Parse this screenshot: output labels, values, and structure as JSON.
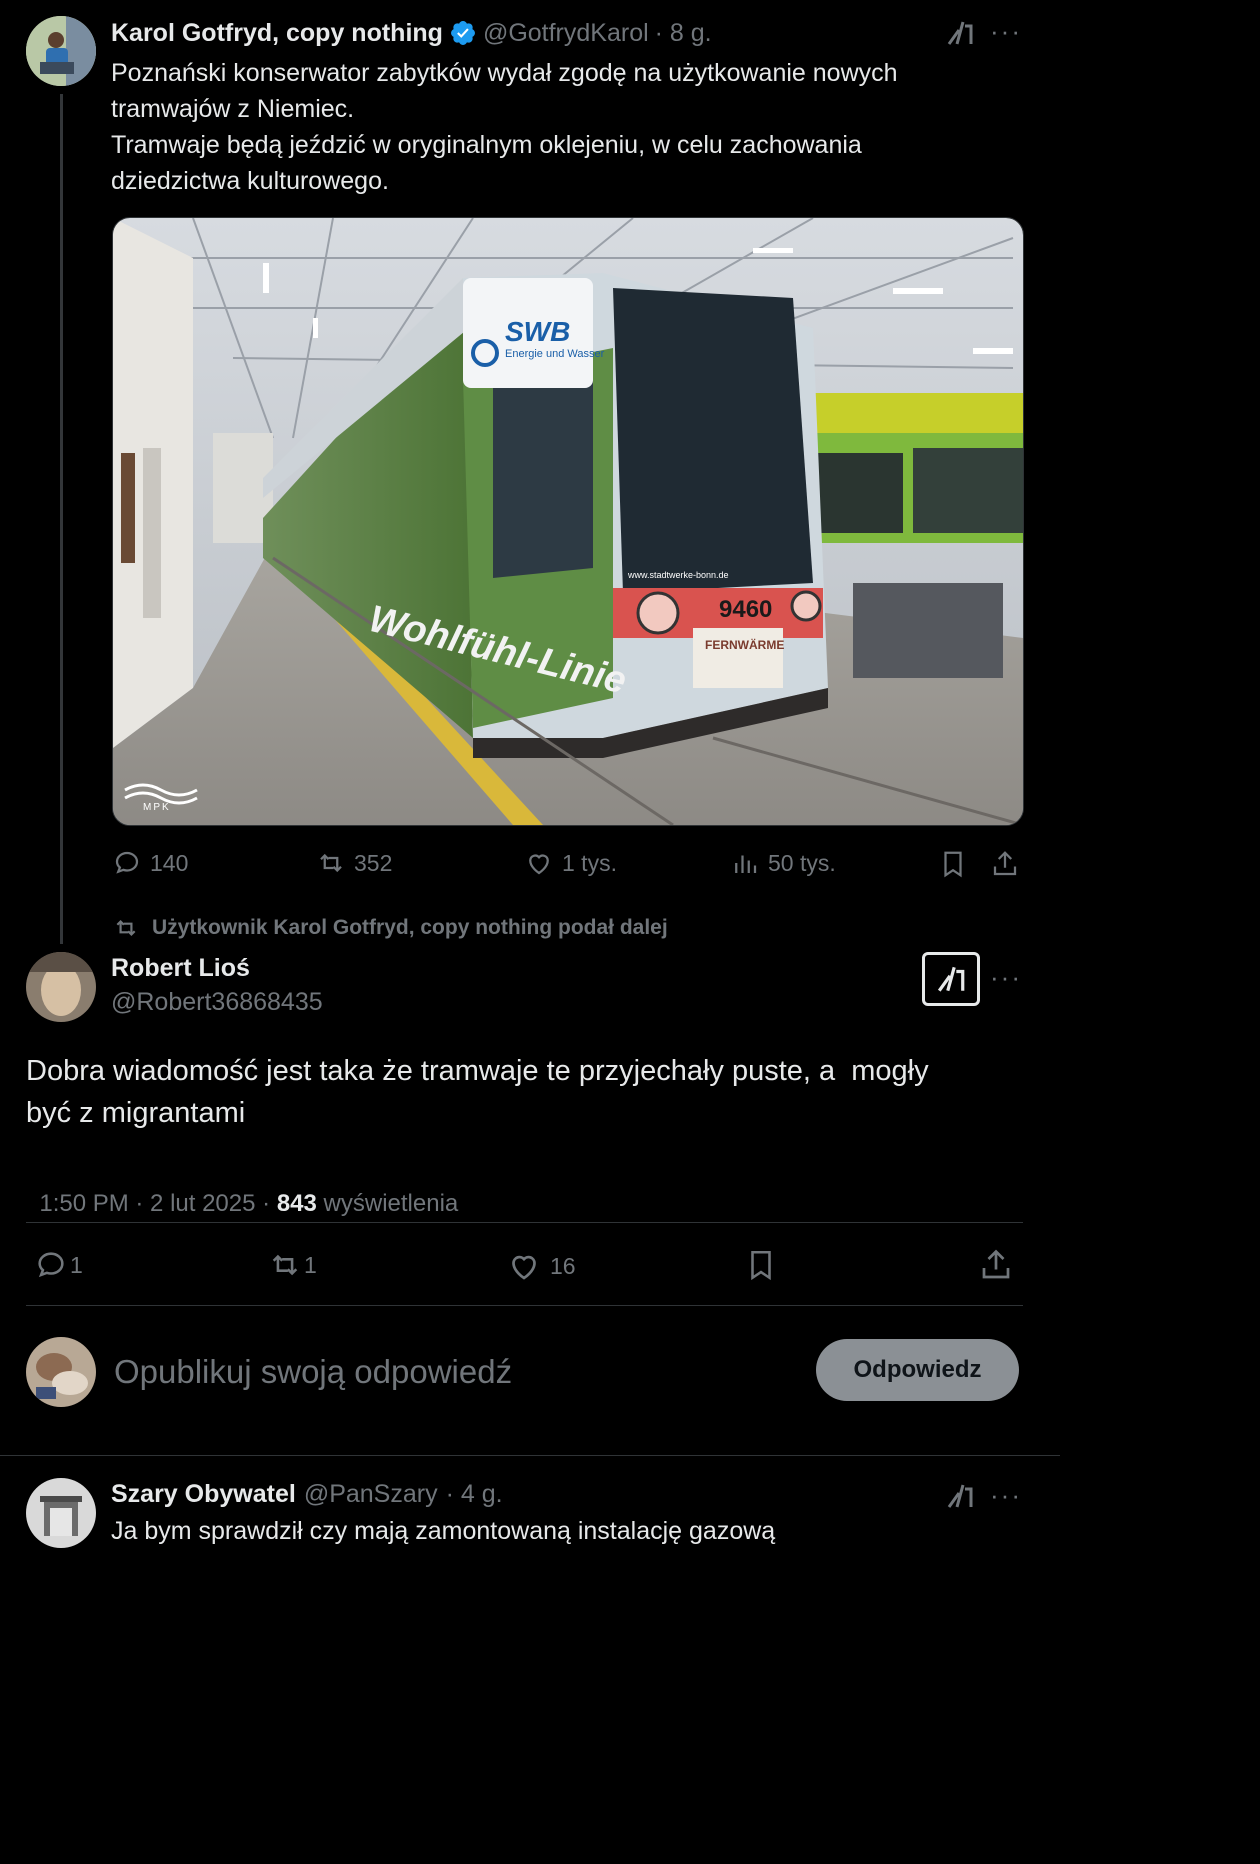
{
  "colors": {
    "bg": "#000000",
    "text": "#e7e9ea",
    "muted": "#71767b",
    "verified": "#1d9bf0",
    "divider": "#2f3336",
    "reply_btn_bg": "#8b9095"
  },
  "tweet1": {
    "name": "Karol Gotfryd, copy nothing",
    "handle": "@GotfrydKarol",
    "time": "· 8 g.",
    "text_line1": "Poznański konserwator zabytków wydał zgodę na użytkowanie nowych",
    "text_line2": "tramwajów z Niemiec.",
    "text_line3": "Tramwaje będą jeździć w oryginalnym oklejeniu, w celu zachowania",
    "text_line4": "dziedzictwa kulturowego.",
    "image": {
      "swb_brand": "SWB",
      "swb_sub": "Energie und Wasser",
      "url_text": "www.stadtwerke-bonn.de",
      "tram_number": "9460",
      "fernwaerme": "FERNWÄRME",
      "side_slogan": "Wohlfühl-Linie",
      "watermark": "MPK"
    },
    "actions": {
      "replies": "140",
      "reposts": "352",
      "likes": "1 tys.",
      "views": "50 tys."
    }
  },
  "repost_label": "Użytkownik Karol Gotfryd, copy nothing podał dalej",
  "main": {
    "name": "Robert Lioś",
    "handle": "@Robert36868435",
    "text_line1": "Dobra wiadomość jest taka że tramwaje te przyjechały puste, a  mogły",
    "text_line2": "być z migrantami",
    "time": "1:50 PM · 2 lut 2025 · ",
    "views_count": "843",
    "views_label": " wyświetlenia",
    "actions": {
      "replies": "1",
      "reposts": "1",
      "likes": "16"
    }
  },
  "reply_box": {
    "placeholder": "Opublikuj swoją odpowiedź",
    "button": "Odpowiedz"
  },
  "tweet3": {
    "name": "Szary Obywatel",
    "handle": "@PanSzary",
    "time": "· 4 g.",
    "text": "Ja bym sprawdził czy mają zamontowaną instalację gazową"
  },
  "icons": [
    "verified-icon",
    "grok-icon",
    "more-icon",
    "reply-icon",
    "repost-icon",
    "like-icon",
    "views-icon",
    "bookmark-icon",
    "share-icon"
  ]
}
